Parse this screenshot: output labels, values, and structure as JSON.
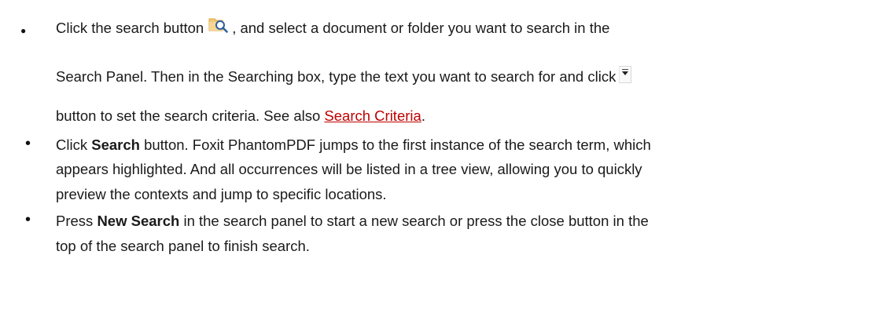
{
  "items": [
    {
      "lines": [
        {
          "before": "Click the search button",
          "after": ", and select a document or folder you want to search in the"
        },
        {
          "text": "Search Panel. Then in the Searching box, type the text you want to search for and click"
        },
        {
          "before": "button to set the search criteria. See also ",
          "link": "Search Criteria",
          "after": "."
        }
      ],
      "icons": {
        "search_button": "folder-search-icon",
        "dropdown_button": "dropdown-arrow-icon"
      }
    },
    {
      "bold": "Search",
      "lines": [
        {
          "before": "Click ",
          "after": " button. Foxit PhantomPDF jumps to the first instance of the search term, which"
        },
        {
          "text": "appears highlighted. And all occurrences will be listed in a tree view, allowing you to quickly"
        },
        {
          "text": "preview the contexts and jump to specific locations."
        }
      ]
    },
    {
      "bold": "New Search",
      "lines": [
        {
          "before": "Press ",
          "after": " in the search panel to start a new search or press the close button in the"
        },
        {
          "text": "top of the search panel to finish search."
        }
      ]
    }
  ],
  "colors": {
    "text": "#1a1a1a",
    "link": "#c00000",
    "icon_folder": "#f0c070",
    "icon_magnifier": "#2f5e9e"
  }
}
